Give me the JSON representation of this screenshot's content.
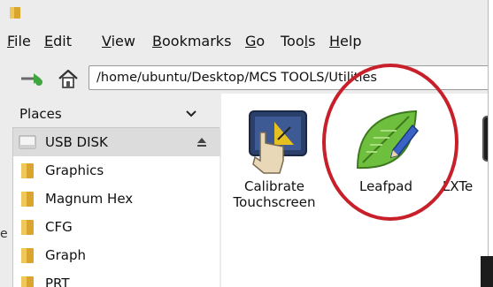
{
  "menubar": {
    "items": [
      {
        "mnemonic": "F",
        "rest": "ile"
      },
      {
        "mnemonic": "E",
        "rest": "dit"
      },
      {
        "mnemonic": "V",
        "rest": "iew"
      },
      {
        "mnemonic": "B",
        "rest": "ookmarks"
      },
      {
        "mnemonic": "G",
        "rest": "o"
      },
      {
        "pre": "Too",
        "mnemonic": "l",
        "rest": "s"
      },
      {
        "mnemonic": "H",
        "rest": "elp"
      }
    ]
  },
  "location": {
    "path": "/home/ubuntu/Desktop/MCS TOOLS/Utilities"
  },
  "sidepane": {
    "header": "Places",
    "items": [
      {
        "label": "USB DISK",
        "icon": "usb-drive-icon"
      },
      {
        "label": "Graphics",
        "icon": "folder-icon"
      },
      {
        "label": "Magnum Hex",
        "icon": "folder-icon"
      },
      {
        "label": "CFG",
        "icon": "folder-icon"
      },
      {
        "label": "Graph",
        "icon": "folder-icon"
      },
      {
        "label": "PRT",
        "icon": "folder-icon"
      }
    ]
  },
  "stray_text": "e",
  "files": [
    {
      "label": "Calibrate Touchscreen",
      "icon": "calibrate-touchscreen-icon"
    },
    {
      "label": "Leafpad",
      "icon": "leafpad-icon"
    },
    {
      "label": "LXTe",
      "icon": "lxterminal-icon"
    }
  ],
  "colors": {
    "highlight_ring": "#c8202a",
    "folder": "#e8b93b",
    "leaf": "#6fbf3f"
  }
}
